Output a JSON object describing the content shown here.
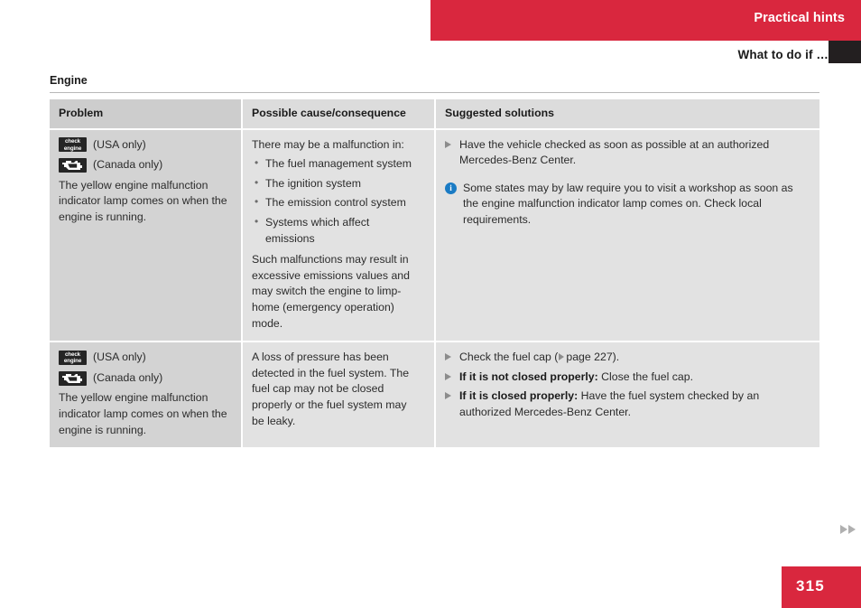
{
  "header": {
    "band_title": "Practical hints",
    "sub_title": "What to do if …"
  },
  "section": {
    "title": "Engine"
  },
  "table": {
    "columns": [
      "Problem",
      "Possible cause/consequence",
      "Suggested solutions"
    ],
    "rows": [
      {
        "problem": {
          "lamps": [
            {
              "icon": "check-engine-text-icon",
              "icon_text_line1": "check",
              "icon_text_line2": "engine",
              "label": "(USA only)"
            },
            {
              "icon": "engine-symbol-icon",
              "label": "(Canada only)"
            }
          ],
          "text": "The yellow engine malfunction indicator lamp comes on when the engine is running."
        },
        "cause": {
          "intro": "There may be a malfunction in:",
          "bullets": [
            "The fuel management system",
            "The ignition system",
            "The emission control system",
            "Systems which affect emissions"
          ],
          "outro": "Such malfunctions may result in excessive emissions values and may switch the engine to limp-home (emergency operation) mode."
        },
        "solutions": {
          "items": [
            {
              "bold": "",
              "text": "Have the vehicle checked as soon as possible at an authorized Mercedes-Benz Center."
            }
          ],
          "note": "Some states may by law require you to visit a workshop as soon as the engine malfunction indicator lamp comes on. Check local requirements."
        }
      },
      {
        "problem": {
          "lamps": [
            {
              "icon": "check-engine-text-icon",
              "icon_text_line1": "check",
              "icon_text_line2": "engine",
              "label": "(USA only)"
            },
            {
              "icon": "engine-symbol-icon",
              "label": "(Canada only)"
            }
          ],
          "text": "The yellow engine malfunction indicator lamp comes on when the engine is running."
        },
        "cause": {
          "intro": "",
          "bullets": [],
          "outro": "A loss of pressure has been detected in the fuel system. The fuel cap may not be closed properly or the fuel system may be leaky."
        },
        "solutions": {
          "items": [
            {
              "bold": "",
              "text_before_ref": "Check the fuel cap (",
              "ref_label": "page 227",
              "text_after_ref": ")."
            },
            {
              "bold": "If it is not closed properly:",
              "text": " Close the fuel cap."
            },
            {
              "bold": "If it is closed properly:",
              "text": " Have the fuel system checked by an authorized Mercedes-Benz Center."
            }
          ],
          "note": ""
        }
      }
    ]
  },
  "footer": {
    "page_number": "315"
  },
  "colors": {
    "brand_red": "#d9273e",
    "tab_black": "#231f20",
    "info_blue": "#1a7bc4",
    "col1_bg": "#d3d3d3",
    "col23_bg": "#e2e2e2"
  }
}
